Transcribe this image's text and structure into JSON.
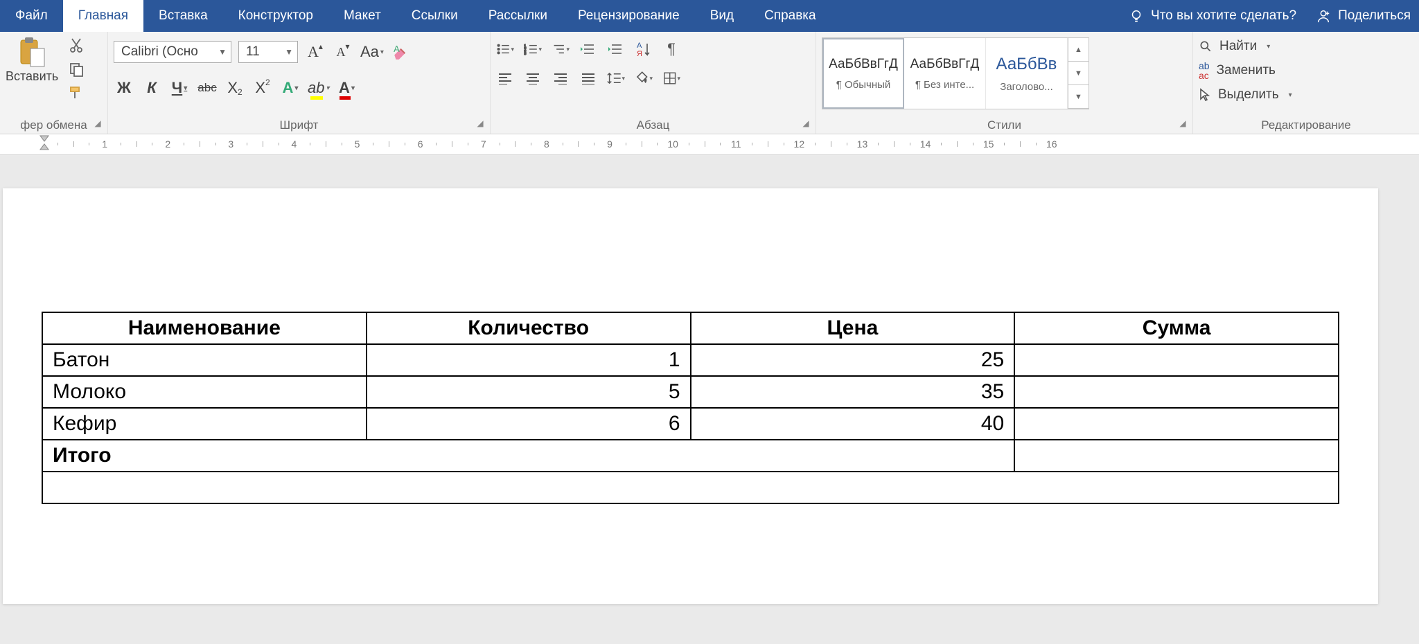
{
  "tabs": {
    "file": "Файл",
    "home": "Главная",
    "insert": "Вставка",
    "design": "Конструктор",
    "layout": "Макет",
    "references": "Ссылки",
    "mailings": "Рассылки",
    "review": "Рецензирование",
    "view": "Вид",
    "help": "Справка"
  },
  "header_right": {
    "tellme": "Что вы хотите сделать?",
    "share": "Поделиться"
  },
  "groups": {
    "clipboard": {
      "paste": "Вставить",
      "label": "фер обмена"
    },
    "font": {
      "name": "Calibri (Осно",
      "size": "11",
      "label": "Шрифт",
      "bold": "Ж",
      "italic": "К",
      "underline": "Ч",
      "strike": "abc",
      "sub": "X",
      "sup": "X",
      "aa": "Aa",
      "effects_a": "A"
    },
    "paragraph": {
      "label": "Абзац"
    },
    "styles": {
      "label": "Стили",
      "preview": "АаБбВвГгД",
      "preview_h1": "АаБбВв",
      "s1": "¶ Обычный",
      "s2": "¶ Без инте...",
      "s3": "Заголово..."
    },
    "editing": {
      "label": "Редактирование",
      "find": "Найти",
      "replace": "Заменить",
      "select": "Выделить"
    }
  },
  "ruler": {
    "nums": [
      1,
      2,
      3,
      4,
      5,
      6,
      7,
      8,
      9,
      10,
      11,
      12,
      13,
      14,
      15,
      16
    ]
  },
  "table": {
    "headers": [
      "Наименование",
      "Количество",
      "Цена",
      "Сумма"
    ],
    "rows": [
      {
        "name": "Батон",
        "qty": "1",
        "price": "25",
        "sum": ""
      },
      {
        "name": "Молоко",
        "qty": "5",
        "price": "35",
        "sum": ""
      },
      {
        "name": "Кефир",
        "qty": "6",
        "price": "40",
        "sum": ""
      }
    ],
    "total_label": "Итого"
  }
}
